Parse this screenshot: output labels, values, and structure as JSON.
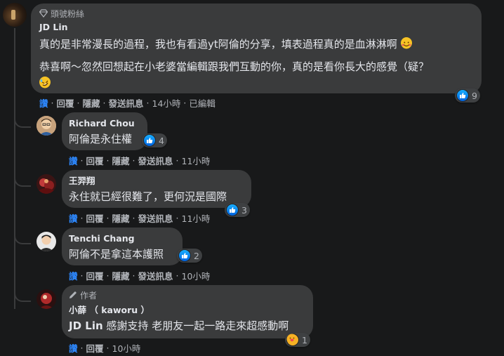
{
  "colors": {
    "background": "#18191a",
    "bubble": "#3a3b3c",
    "text": "#e4e6eb",
    "muted": "#b0b3b8",
    "like_blue": "#2d88ff"
  },
  "comments": [
    {
      "badge": "頭號粉絲",
      "badge_icon": "diamond-icon",
      "author": "JD Lin",
      "lines": [
        "真的是非常漫長的過程，我也有看過yt阿倫的分享，填表過程真的是血淋淋啊",
        "恭喜啊～忽然回想起在小老婆當編輯跟我們互動的你，真的是看你長大的感覺（疑？"
      ],
      "reaction_count": "9",
      "actions": {
        "like": "讚",
        "reply": "回覆",
        "hide": "隱藏",
        "message": "發送訊息",
        "time": "14小時",
        "edited": "已編輯"
      }
    },
    {
      "author": "Richard Chou",
      "text": "阿倫是永住權",
      "reaction_count": "4",
      "actions": {
        "like": "讚",
        "reply": "回覆",
        "hide": "隱藏",
        "message": "發送訊息",
        "time": "11小時"
      }
    },
    {
      "author": "王羿翔",
      "text": "永住就已經很難了，更何況是國際",
      "reaction_count": "3",
      "actions": {
        "like": "讚",
        "reply": "回覆",
        "hide": "隱藏",
        "message": "發送訊息",
        "time": "11小時"
      }
    },
    {
      "author": "Tenchi Chang",
      "text": "阿倫不是拿這本護照",
      "reaction_count": "2",
      "actions": {
        "like": "讚",
        "reply": "回覆",
        "hide": "隱藏",
        "message": "發送訊息",
        "time": "10小時"
      }
    },
    {
      "badge": "作者",
      "badge_icon": "pencil-icon",
      "author": "小薛 （ kaworu ）",
      "mention": "JD Lin",
      "text": "感謝支持 老朋友一起一路走來超感動啊",
      "reaction_count": "1",
      "actions": {
        "like": "讚",
        "reply": "回覆",
        "time": "10小時"
      }
    }
  ]
}
